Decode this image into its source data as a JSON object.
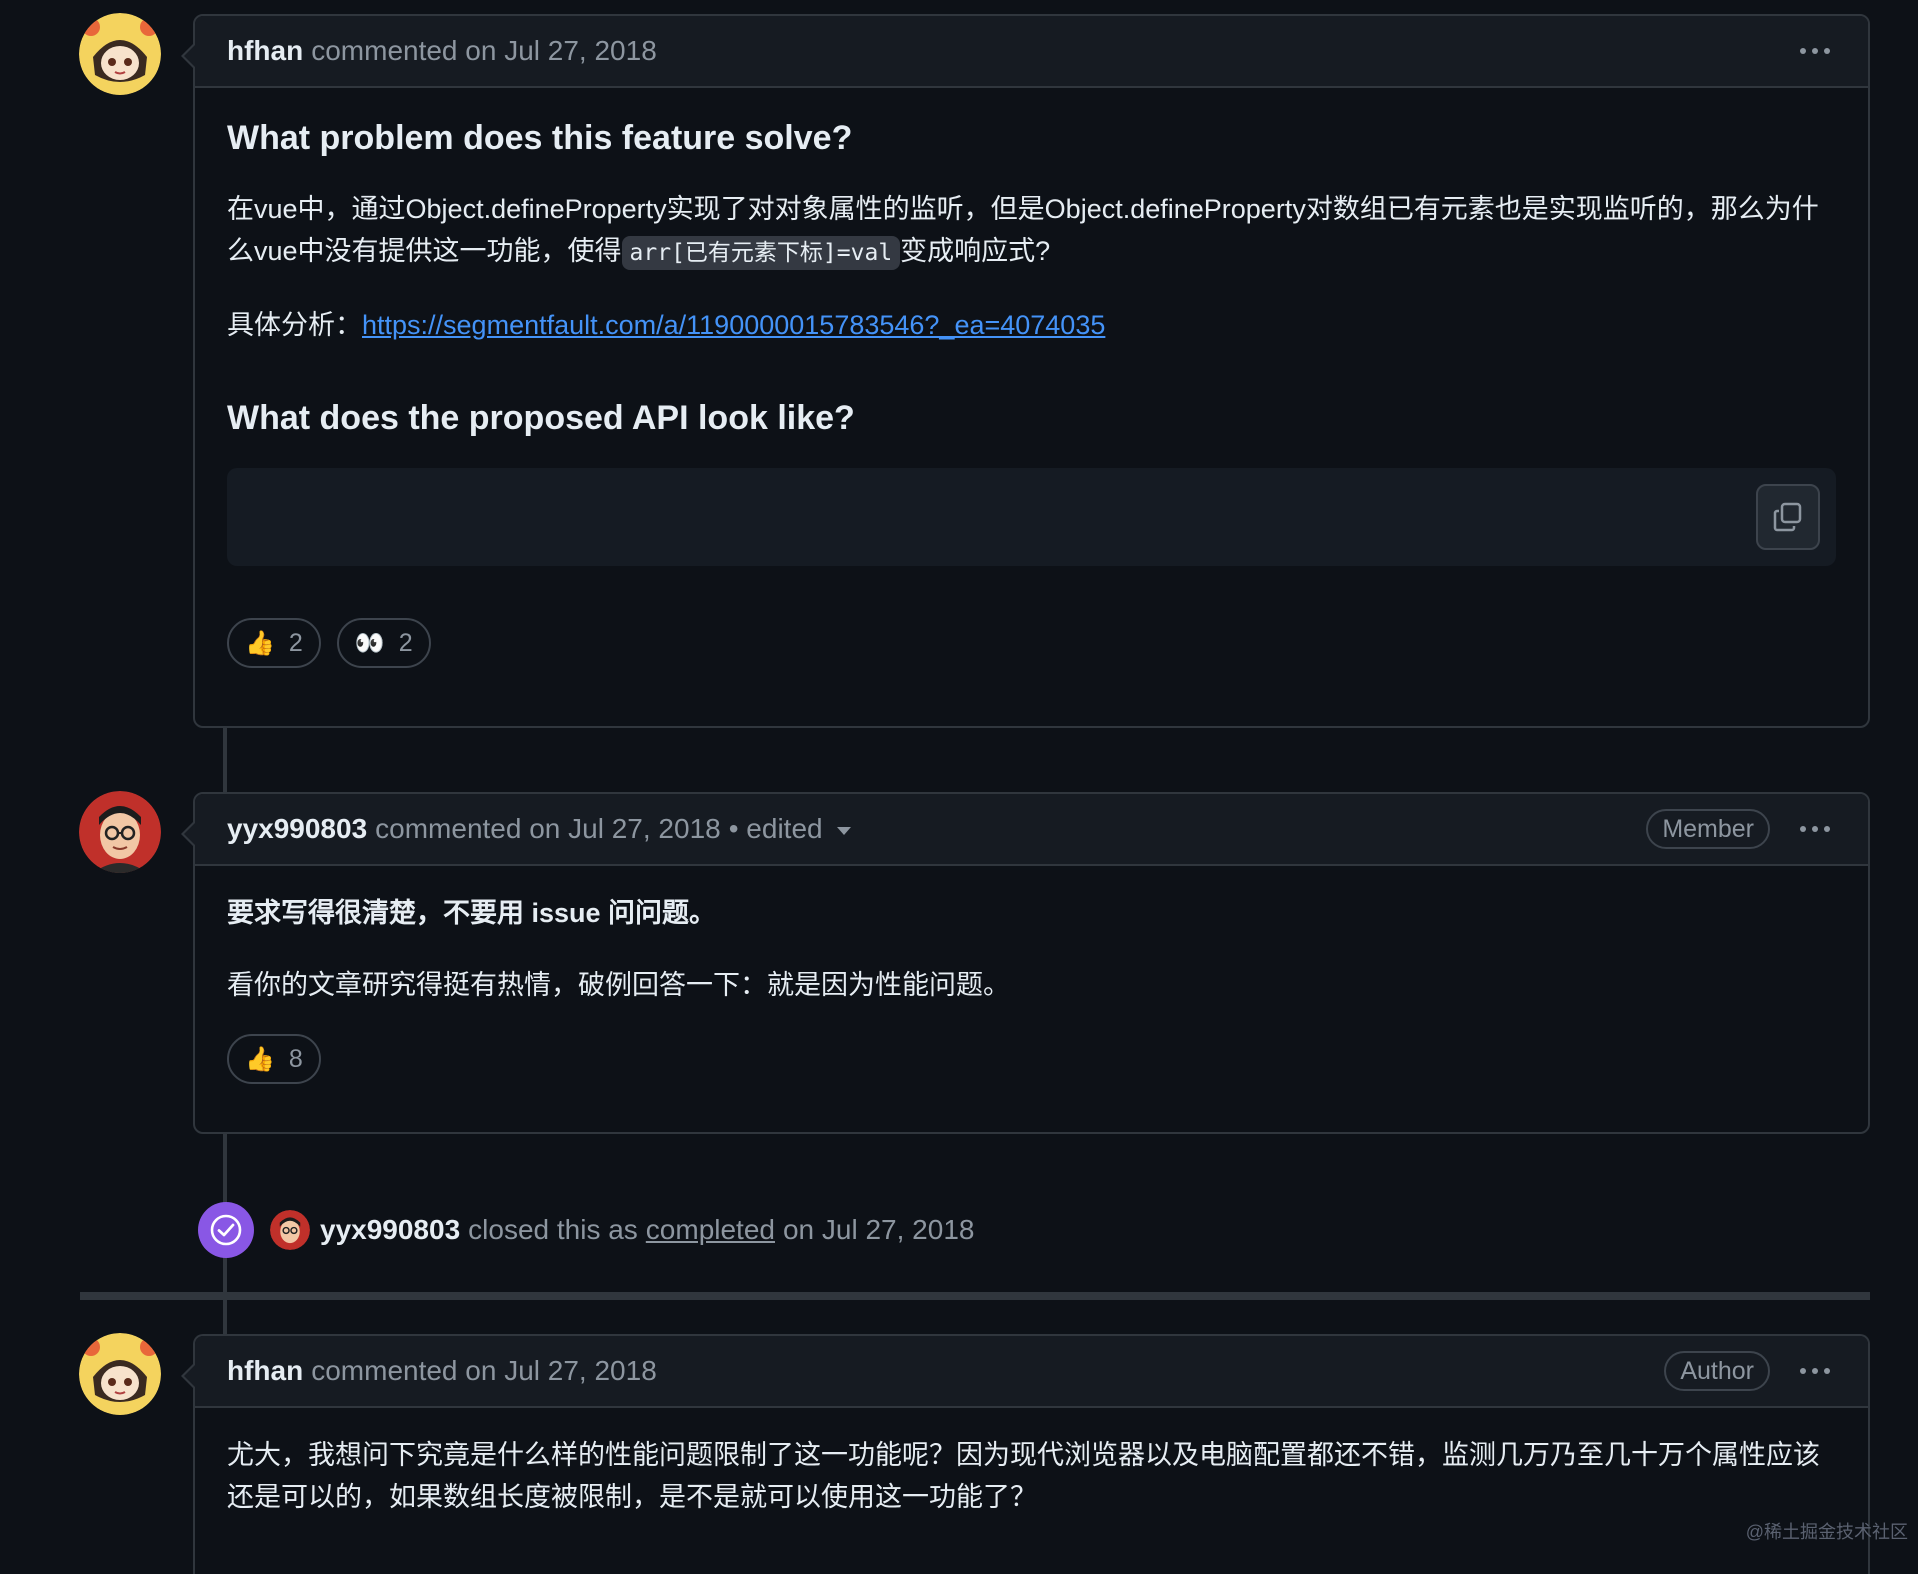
{
  "comments": [
    {
      "author": "hfhan",
      "meta": "commented on Jul 27, 2018",
      "heading1": "What problem does this feature solve?",
      "para1_before": "在vue中，通过Object.defineProperty实现了对对象属性的监听，但是Object.defineProperty对数组已有元素也是实现监听的，那么为什么vue中没有提供这一功能，使得",
      "para1_code": "arr[已有元素下标]=val",
      "para1_after": "变成响应式?",
      "analysis_label": "具体分析：",
      "analysis_link": "https://segmentfault.com/a/1190000015783546?_ea=4074035",
      "heading2": "What does the proposed API look like?",
      "reactions": [
        {
          "emoji": "👍",
          "icon": "thumbs-up-icon",
          "count": "2"
        },
        {
          "emoji": "👀",
          "icon": "eyes-icon",
          "count": "2"
        }
      ]
    },
    {
      "author": "yyx990803",
      "meta": "commented on Jul 27, 2018",
      "edited": "• edited",
      "badge": "Member",
      "bold_line": "要求写得很清楚，不要用 issue 问问题。",
      "para": "看你的文章研究得挺有热情，破例回答一下：就是因为性能问题。",
      "reactions": [
        {
          "emoji": "👍",
          "icon": "thumbs-up-icon",
          "count": "8"
        }
      ]
    },
    {
      "author": "hfhan",
      "meta": "commented on Jul 27, 2018",
      "badge": "Author",
      "para": "尤大，我想问下究竟是什么样的性能问题限制了这一功能呢？因为现代浏览器以及电脑配置都还不错，监测几万乃至几十万个属性应该还是可以的，如果数组长度被限制，是不是就可以使用这一功能了？"
    }
  ],
  "event": {
    "icon": "check-circle-icon",
    "actor": "yyx990803",
    "text_before": "closed this as",
    "state": "completed",
    "text_after": "on Jul 27, 2018"
  },
  "watermark": "@稀土掘金技术社区",
  "colors": {
    "background": "#0d1117",
    "header": "#161b22",
    "border": "#30363d",
    "link": "#4493f8",
    "closed_badge": "#8957e5"
  }
}
